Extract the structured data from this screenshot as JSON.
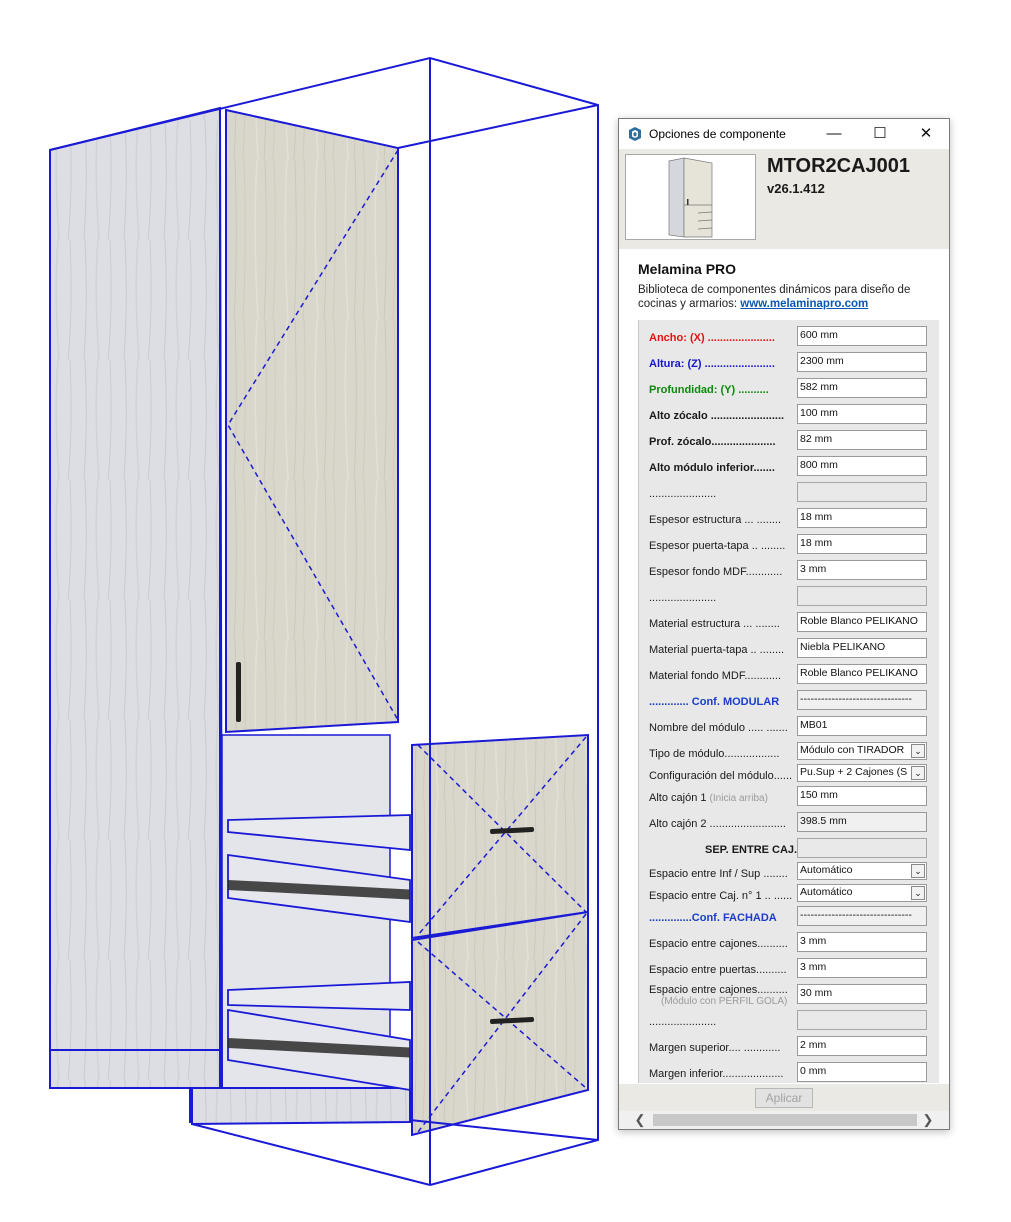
{
  "window": {
    "title": "Opciones de componente",
    "minimize": "—",
    "maximize": "☐",
    "close": "✕"
  },
  "component": {
    "code": "MTOR2CAJ001",
    "version": "v26.1.412"
  },
  "brand": {
    "name": "Melamina PRO",
    "description": "Biblioteca de componentes dinámicos para diseño de cocinas y armarios:",
    "website": "www.melaminapro.com"
  },
  "form": {
    "rows": [
      {
        "label": "Ancho: (X) ......................",
        "value": "600 mm",
        "style": "red",
        "kind": "input"
      },
      {
        "label": "Altura: (Z) .......................",
        "value": "2300 mm",
        "style": "blue",
        "kind": "input"
      },
      {
        "label": "Profundidad: (Y) ..........",
        "value": "582 mm",
        "style": "green",
        "kind": "input"
      },
      {
        "label": "Alto zócalo ........................",
        "value": "100 mm",
        "style": "bold",
        "kind": "input"
      },
      {
        "label": "Prof. zócalo.....................",
        "value": "82 mm",
        "style": "bold",
        "kind": "input"
      },
      {
        "label": "Alto módulo inferior.......",
        "value": "800 mm",
        "style": "bold",
        "kind": "input"
      },
      {
        "label": "                  ......................",
        "value": "",
        "style": "plain",
        "kind": "empty"
      },
      {
        "label": "Espesor estructura ... ........",
        "value": "18 mm",
        "style": "plain",
        "kind": "input"
      },
      {
        "label": "Espesor puerta-tapa .. ........",
        "value": "18 mm",
        "style": "plain",
        "kind": "input"
      },
      {
        "label": "Espesor fondo MDF............",
        "value": "3 mm",
        "style": "plain",
        "kind": "input"
      },
      {
        "label": "                  ......................",
        "value": "",
        "style": "plain",
        "kind": "empty"
      },
      {
        "label": "Material estructura ... ........",
        "value": "Roble Blanco PELIKANO",
        "style": "plain",
        "kind": "input"
      },
      {
        "label": "Material puerta-tapa .. ........",
        "value": "Niebla PELIKANO",
        "style": "plain",
        "kind": "input"
      },
      {
        "label": "Material fondo MDF............",
        "value": "Roble Blanco PELIKANO",
        "style": "plain",
        "kind": "input"
      },
      {
        "label": "............. Conf. MODULAR",
        "value": "--------------------------------",
        "style": "link",
        "kind": "ro"
      },
      {
        "label": "Nombre del módulo ..... .......",
        "value": "MB01",
        "style": "plain",
        "kind": "input"
      },
      {
        "label": "Tipo de módulo..................",
        "value": "Módulo con TIRADOR",
        "style": "plain",
        "kind": "select"
      },
      {
        "label": "Configuración del módulo......",
        "value": "Pu.Sup + 2 Cajones (S",
        "style": "plain",
        "kind": "select"
      },
      {
        "label": "Alto cajón 1 ",
        "sub": "(Inicia arriba)",
        "value": "150 mm",
        "style": "plain",
        "kind": "input"
      },
      {
        "label": "Alto cajón 2 .........................",
        "value": "398.5 mm",
        "style": "plain",
        "kind": "ro"
      },
      {
        "label": "SEP. ENTRE CAJ.",
        "value": "",
        "style": "bold-right",
        "kind": "empty"
      },
      {
        "label": "Espacio entre Inf / Sup ........",
        "value": "Automático",
        "style": "plain",
        "kind": "select"
      },
      {
        "label": "Espacio entre Caj. n° 1 .. ......",
        "value": "Automático",
        "style": "plain",
        "kind": "select"
      },
      {
        "label": "..............Conf. FACHADA",
        "value": "--------------------------------",
        "style": "link",
        "kind": "ro"
      },
      {
        "label": "Espacio entre cajones..........",
        "value": "3 mm",
        "style": "plain",
        "kind": "input"
      },
      {
        "label": "Espacio entre puertas..........",
        "value": "3 mm",
        "style": "plain",
        "kind": "input"
      },
      {
        "label": "Espacio entre cajones..........",
        "sub2": "(Módulo con PERFIL GOLA)",
        "value": "30 mm",
        "style": "plain",
        "kind": "input"
      },
      {
        "label": "                  ......................",
        "value": "",
        "style": "plain",
        "kind": "empty"
      },
      {
        "label": "Margen superior.... ............",
        "value": "2 mm",
        "style": "plain",
        "kind": "input"
      },
      {
        "label": "Margen inferior....................",
        "value": "0 mm",
        "style": "plain",
        "kind": "input"
      }
    ]
  },
  "footer": {
    "apply_label": "Aplicar"
  },
  "scrollbar": {
    "left": "❮",
    "right": "❯"
  },
  "colors": {
    "selection_blue": "#1a1ad6",
    "wood_light": "#dcdde3",
    "door_beige": "#d9d5c8"
  }
}
